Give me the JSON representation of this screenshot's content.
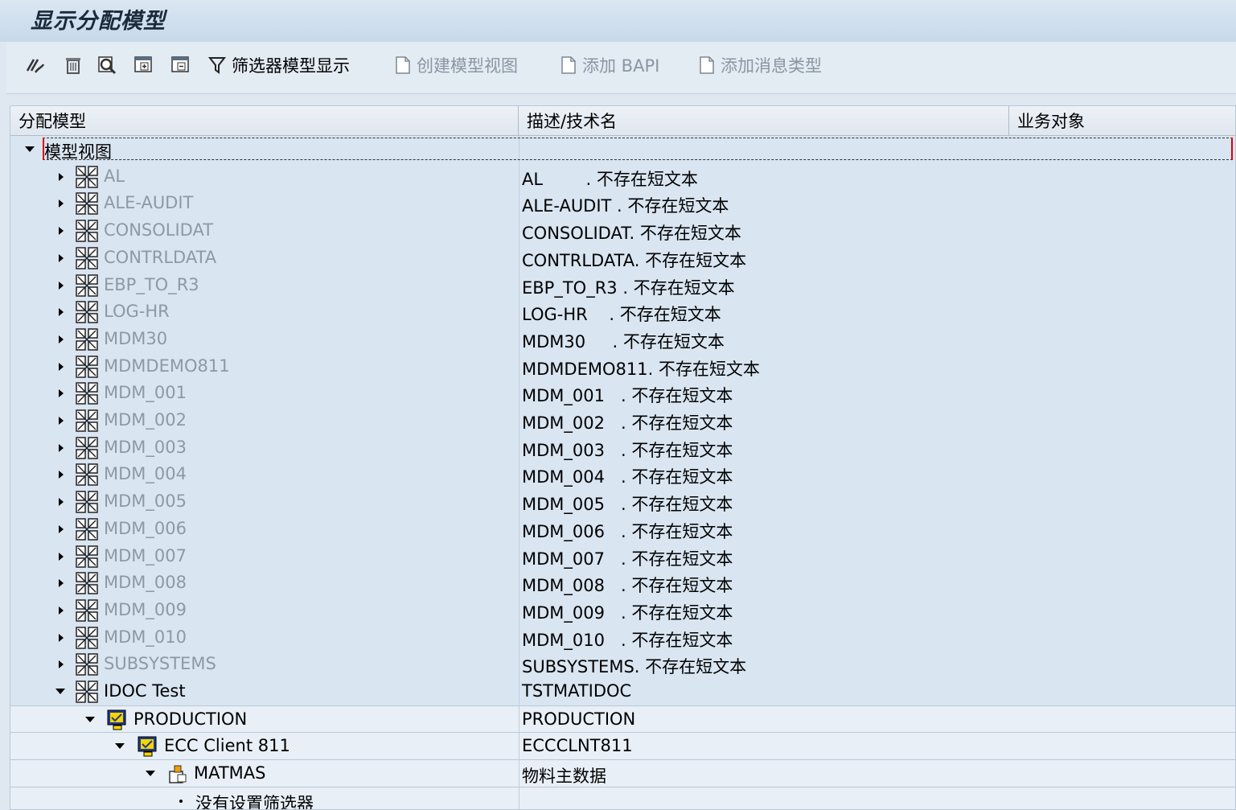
{
  "title": "显示分配模型",
  "toolbar": {
    "filter_display_label": "筛选器模型显示",
    "create_view_label": "创建模型视图",
    "add_bapi_label": "添加 BAPI",
    "add_message_type_label": "添加消息类型"
  },
  "columns": [
    "分配模型",
    "描述/技术名",
    "业务对象"
  ],
  "tree": {
    "root_label": "模型视图",
    "models": [
      {
        "name": "AL",
        "desc": "AL        . 不存在短文本"
      },
      {
        "name": "ALE-AUDIT",
        "desc": "ALE-AUDIT . 不存在短文本"
      },
      {
        "name": "CONSOLIDAT",
        "desc": "CONSOLIDAT. 不存在短文本"
      },
      {
        "name": "CONTRLDATA",
        "desc": "CONTRLDATA. 不存在短文本"
      },
      {
        "name": "EBP_TO_R3",
        "desc": "EBP_TO_R3 . 不存在短文本"
      },
      {
        "name": "LOG-HR",
        "desc": "LOG-HR    . 不存在短文本"
      },
      {
        "name": "MDM30",
        "desc": "MDM30     . 不存在短文本"
      },
      {
        "name": "MDMDEMO811",
        "desc": "MDMDEMO811. 不存在短文本"
      },
      {
        "name": "MDM_001",
        "desc": "MDM_001   . 不存在短文本"
      },
      {
        "name": "MDM_002",
        "desc": "MDM_002   . 不存在短文本"
      },
      {
        "name": "MDM_003",
        "desc": "MDM_003   . 不存在短文本"
      },
      {
        "name": "MDM_004",
        "desc": "MDM_004   . 不存在短文本"
      },
      {
        "name": "MDM_005",
        "desc": "MDM_005   . 不存在短文本"
      },
      {
        "name": "MDM_006",
        "desc": "MDM_006   . 不存在短文本"
      },
      {
        "name": "MDM_007",
        "desc": "MDM_007   . 不存在短文本"
      },
      {
        "name": "MDM_008",
        "desc": "MDM_008   . 不存在短文本"
      },
      {
        "name": "MDM_009",
        "desc": "MDM_009   . 不存在短文本"
      },
      {
        "name": "MDM_010",
        "desc": "MDM_010   . 不存在短文本"
      },
      {
        "name": "SUBSYSTEMS",
        "desc": "SUBSYSTEMS. 不存在短文本"
      },
      {
        "name": "IDOC Test",
        "desc": "TSTMATIDOC"
      }
    ],
    "expanded": {
      "sender": {
        "name": "PRODUCTION",
        "desc": "PRODUCTION"
      },
      "receiver": {
        "name": "ECC Client 811",
        "desc": "ECCCLNT811"
      },
      "message": {
        "name": "MATMAS",
        "desc": "物料主数据"
      },
      "filter_note": "没有设置筛选器"
    }
  },
  "icons": {
    "toolbar": [
      "change-icon",
      "trash-icon",
      "display-icon",
      "expand-icon",
      "collapse-icon",
      "filter-icon",
      "document-icon"
    ],
    "tree": [
      "model-view-icon",
      "system-icon",
      "message-type-icon"
    ]
  }
}
